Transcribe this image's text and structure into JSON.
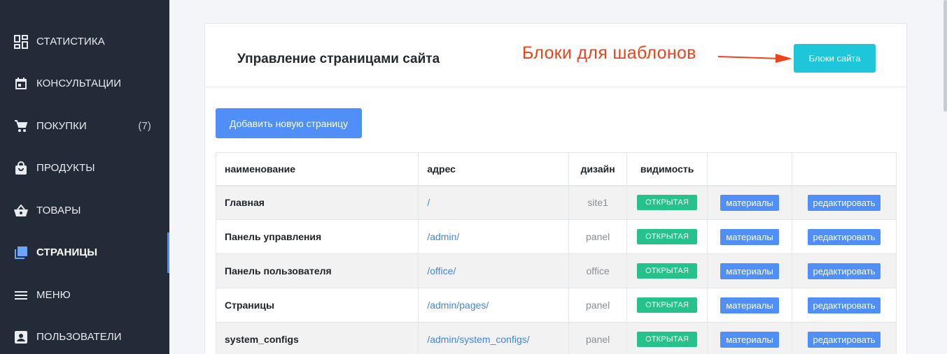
{
  "sidebar": {
    "items": [
      {
        "label": "СТАТИСТИКА",
        "icon": "dashboard-icon"
      },
      {
        "label": "КОНСУЛЬТАЦИИ",
        "icon": "calendar-icon"
      },
      {
        "label": "ПОКУПКИ",
        "icon": "cart-icon",
        "count": "(7)"
      },
      {
        "label": "ПРОДУКТЫ",
        "icon": "shopping-bag-icon"
      },
      {
        "label": "ТОВАРЫ",
        "icon": "basket-icon"
      },
      {
        "label": "СТРАНИЦЫ",
        "icon": "pages-icon",
        "active": true
      },
      {
        "label": "МЕНЮ",
        "icon": "menu-icon"
      },
      {
        "label": "ПОЛЬЗОВАТЕЛИ",
        "icon": "user-icon"
      }
    ]
  },
  "header": {
    "title": "Управление страницами сайта",
    "annotation": "Блоки для шаблонов",
    "blocks_button": "Блоки сайта"
  },
  "add_button": "Добавить новую страницу",
  "table": {
    "columns": [
      "наименование",
      "адрес",
      "дизайн",
      "видимость",
      "",
      ""
    ],
    "rows": [
      {
        "name": "Главная",
        "address": "/",
        "design": "site1",
        "visibility": "открытая",
        "materials": "материалы",
        "edit": "редактировать"
      },
      {
        "name": "Панель управления",
        "address": "/admin/",
        "design": "panel",
        "visibility": "открытая",
        "materials": "материалы",
        "edit": "редактировать"
      },
      {
        "name": "Панель пользователя",
        "address": "/office/",
        "design": "office",
        "visibility": "открытая",
        "materials": "материалы",
        "edit": "редактировать"
      },
      {
        "name": "Страницы",
        "address": "/admin/pages/",
        "design": "panel",
        "visibility": "открытая",
        "materials": "материалы",
        "edit": "редактировать"
      },
      {
        "name": "system_configs",
        "address": "/admin/system_configs/",
        "design": "panel",
        "visibility": "открытая",
        "materials": "материалы",
        "edit": "редактировать"
      }
    ]
  },
  "colors": {
    "sidebar_bg": "#232b38",
    "accent": "#4f8ff7",
    "cyan": "#1ec6d9",
    "badge_green": "#26c28c",
    "annotation_red": "#f0421a"
  }
}
